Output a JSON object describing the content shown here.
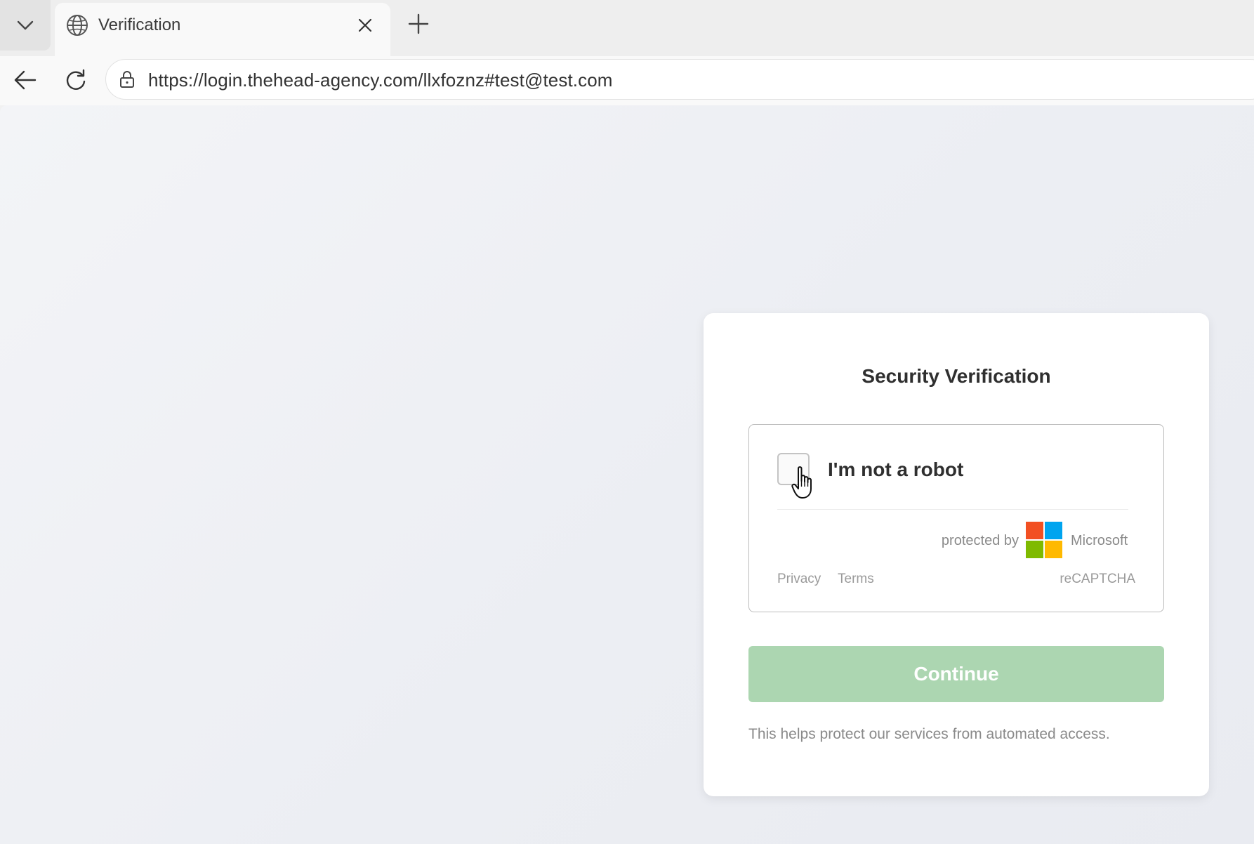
{
  "browser": {
    "tab": {
      "title": "Verification",
      "favicon_icon": "globe-icon",
      "close_icon": "close-icon"
    },
    "new_tab_icon": "plus-icon",
    "tab_menu_icon": "chevron-down-icon",
    "toolbar": {
      "back_icon": "arrow-left-icon",
      "reload_icon": "reload-icon"
    },
    "address_bar": {
      "lock_icon": "lock-icon",
      "url": "https://login.thehead-agency.com/llxfoznz#test@test.com"
    }
  },
  "page": {
    "card": {
      "title": "Security Verification",
      "recaptcha": {
        "checkbox_checked": false,
        "label": "I'm not a robot",
        "protected_by": "protected by",
        "brand": "Microsoft",
        "brand_icon": "microsoft-logo-icon",
        "privacy": "Privacy",
        "terms": "Terms",
        "service": "reCAPTCHA"
      },
      "continue_label": "Continue",
      "helper_text": "This helps protect our services from automated access."
    },
    "colors": {
      "continue_button": "#acd6b1",
      "ms_red": "#f25022",
      "ms_green": "#7fba00",
      "ms_blue": "#00a4ef",
      "ms_yellow": "#ffb900"
    }
  }
}
